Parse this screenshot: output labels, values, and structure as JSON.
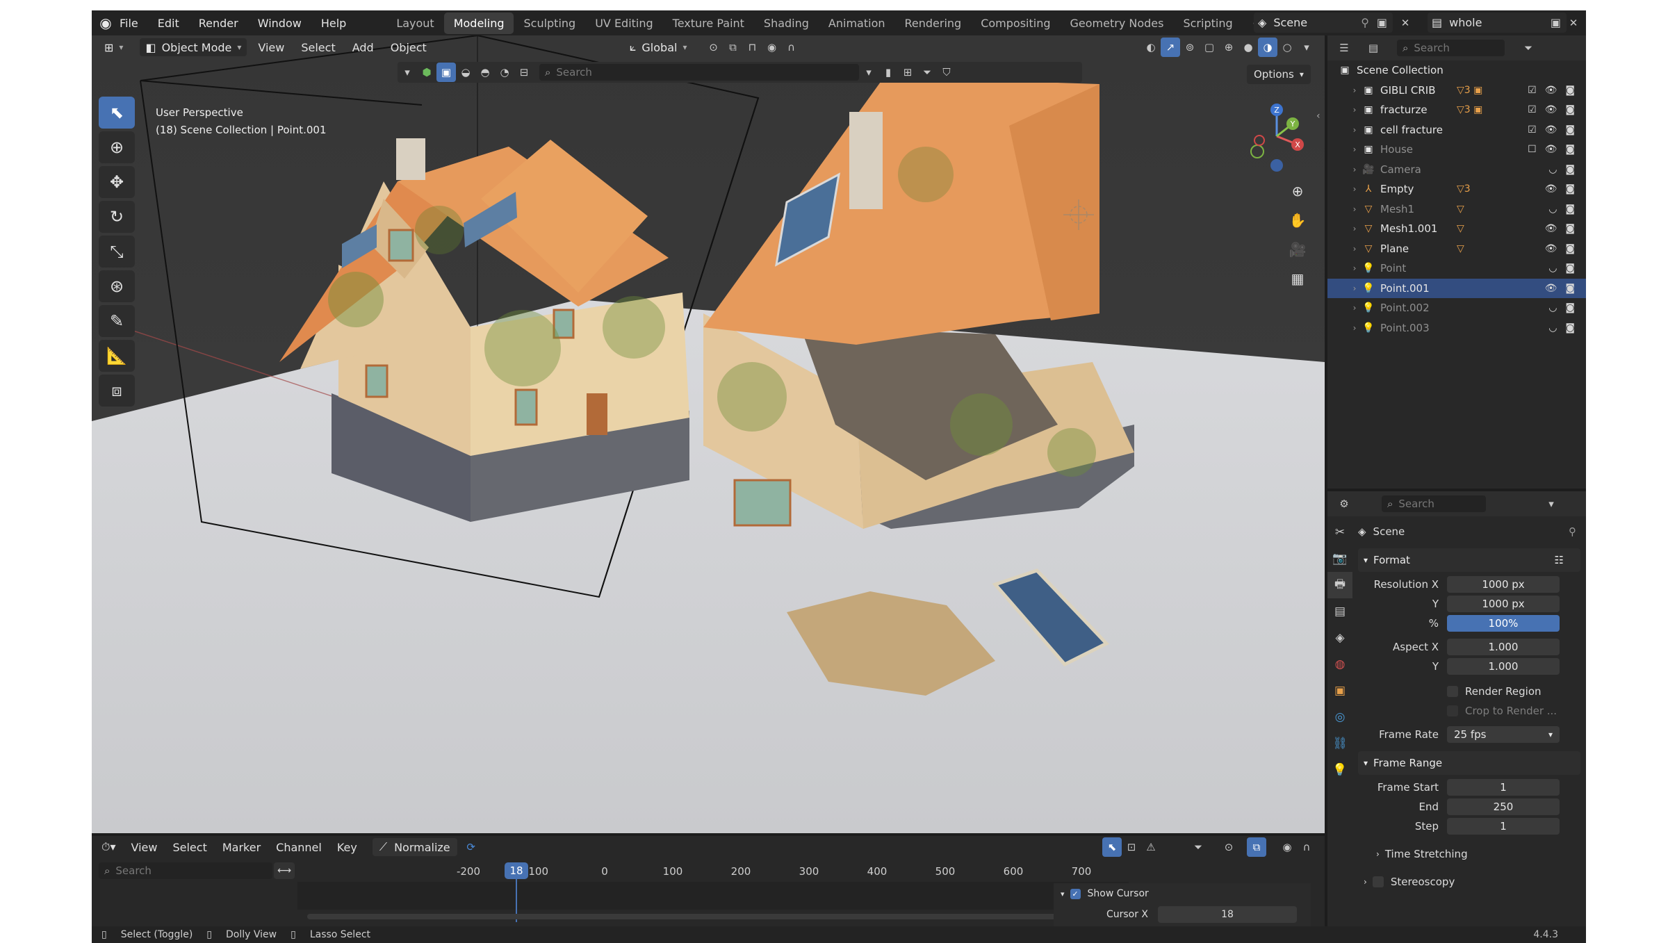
{
  "topbar": {
    "menus": [
      "File",
      "Edit",
      "Render",
      "Window",
      "Help"
    ],
    "workspaces": [
      "Layout",
      "Modeling",
      "Sculpting",
      "UV Editing",
      "Texture Paint",
      "Shading",
      "Animation",
      "Rendering",
      "Compositing",
      "Geometry Nodes",
      "Scripting"
    ],
    "active_workspace": "Modeling",
    "scene": "Scene",
    "view_layer": "whole"
  },
  "viewport": {
    "mode": "Object Mode",
    "menus": [
      "View",
      "Select",
      "Add",
      "Object"
    ],
    "orientation": "Global",
    "search_placeholder": "Search",
    "options_label": "Options",
    "overlay_line1": "User Perspective",
    "overlay_line2": "(18) Scene Collection | Point.001"
  },
  "outliner": {
    "search_placeholder": "Search",
    "root": "Scene Collection",
    "rows": [
      {
        "name": "GIBLI CRIB",
        "icon": "collection-icon",
        "mod": "▽3 ▣",
        "state": "normal"
      },
      {
        "name": "fracturze",
        "icon": "collection-icon",
        "mod": "▽3 ▣",
        "state": "normal"
      },
      {
        "name": "cell fracture",
        "icon": "collection-icon",
        "mod": "",
        "state": "normal"
      },
      {
        "name": "House",
        "icon": "collection-icon",
        "mod": "",
        "state": "dim"
      },
      {
        "name": "Camera",
        "icon": "camera-icon",
        "mod": "",
        "state": "dim"
      },
      {
        "name": "Empty",
        "icon": "empty-icon",
        "mod": "▽3",
        "state": "normal"
      },
      {
        "name": "Mesh1",
        "icon": "mesh-icon",
        "mod": "▽",
        "state": "dim"
      },
      {
        "name": "Mesh1.001",
        "icon": "mesh-icon",
        "mod": "▽",
        "state": "normal"
      },
      {
        "name": "Plane",
        "icon": "mesh-icon",
        "mod": "▽",
        "state": "normal"
      },
      {
        "name": "Point",
        "icon": "light-icon",
        "mod": "",
        "state": "dim"
      },
      {
        "name": "Point.001",
        "icon": "light-icon",
        "mod": "",
        "state": "selected"
      },
      {
        "name": "Point.002",
        "icon": "light-icon",
        "mod": "",
        "state": "dim"
      },
      {
        "name": "Point.003",
        "icon": "light-icon",
        "mod": "",
        "state": "dim"
      }
    ]
  },
  "properties": {
    "search_placeholder": "Search",
    "context": "Scene",
    "format_section": "Format",
    "resolution_x_label": "Resolution X",
    "resolution_x": "1000 px",
    "resolution_y_label": "Y",
    "resolution_y": "1000 px",
    "percent_label": "%",
    "percent": "100%",
    "aspect_x_label": "Aspect X",
    "aspect_x": "1.000",
    "aspect_y_label": "Y",
    "aspect_y": "1.000",
    "render_region": "Render Region",
    "crop_to_render": "Crop to Render ...",
    "frame_rate_label": "Frame Rate",
    "frame_rate": "25 fps",
    "frame_range_section": "Frame Range",
    "frame_start_label": "Frame Start",
    "frame_start": "1",
    "end_label": "End",
    "end": "250",
    "step_label": "Step",
    "step": "1",
    "time_stretching": "Time Stretching",
    "stereoscopy": "Stereoscopy"
  },
  "timeline": {
    "menus": [
      "View",
      "Select",
      "Marker",
      "Channel",
      "Key"
    ],
    "normalize": "Normalize",
    "search_placeholder": "Search",
    "ticks": [
      "-200",
      "-100",
      "0",
      "100",
      "200",
      "300",
      "400",
      "500",
      "600",
      "700"
    ],
    "current_frame": "18",
    "show_cursor": "Show Cursor",
    "cursor_x_label": "Cursor X",
    "cursor_x": "18"
  },
  "status": {
    "items": [
      "Select (Toggle)",
      "Dolly View",
      "Lasso Select"
    ],
    "version": "4.4.3"
  }
}
